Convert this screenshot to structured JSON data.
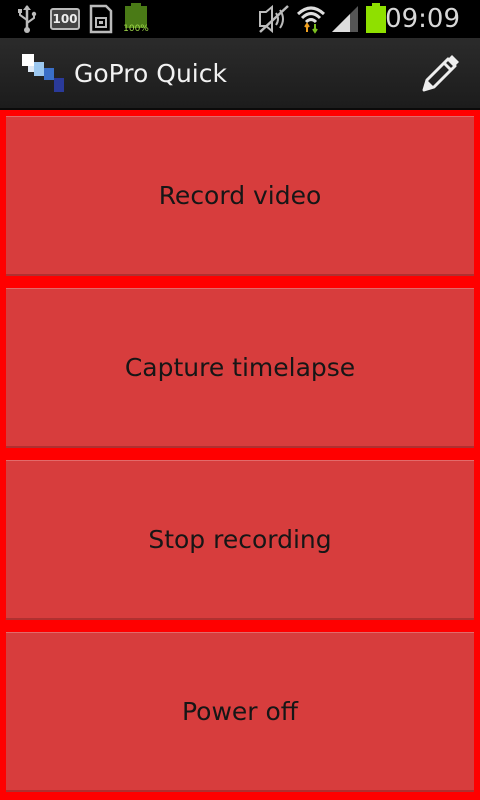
{
  "status_bar": {
    "time": "09:09",
    "notification_badge": "100",
    "battery_small_label": "100%",
    "icons": [
      "usb-icon",
      "notification-badge-icon",
      "sd-card-icon",
      "battery-full-small-icon",
      "mute-icon",
      "wifi-icon",
      "signal-icon",
      "battery-icon"
    ]
  },
  "action_bar": {
    "title": "GoPro Quick",
    "logo_icon": "app-logo-icon",
    "edit_icon": "pencil-icon"
  },
  "buttons": [
    {
      "label": "Record video"
    },
    {
      "label": "Capture timelapse"
    },
    {
      "label": "Stop recording"
    },
    {
      "label": "Power off"
    }
  ],
  "colors": {
    "background": "#ff0000",
    "button": "#d73d3d",
    "action_bar": "#222222"
  }
}
